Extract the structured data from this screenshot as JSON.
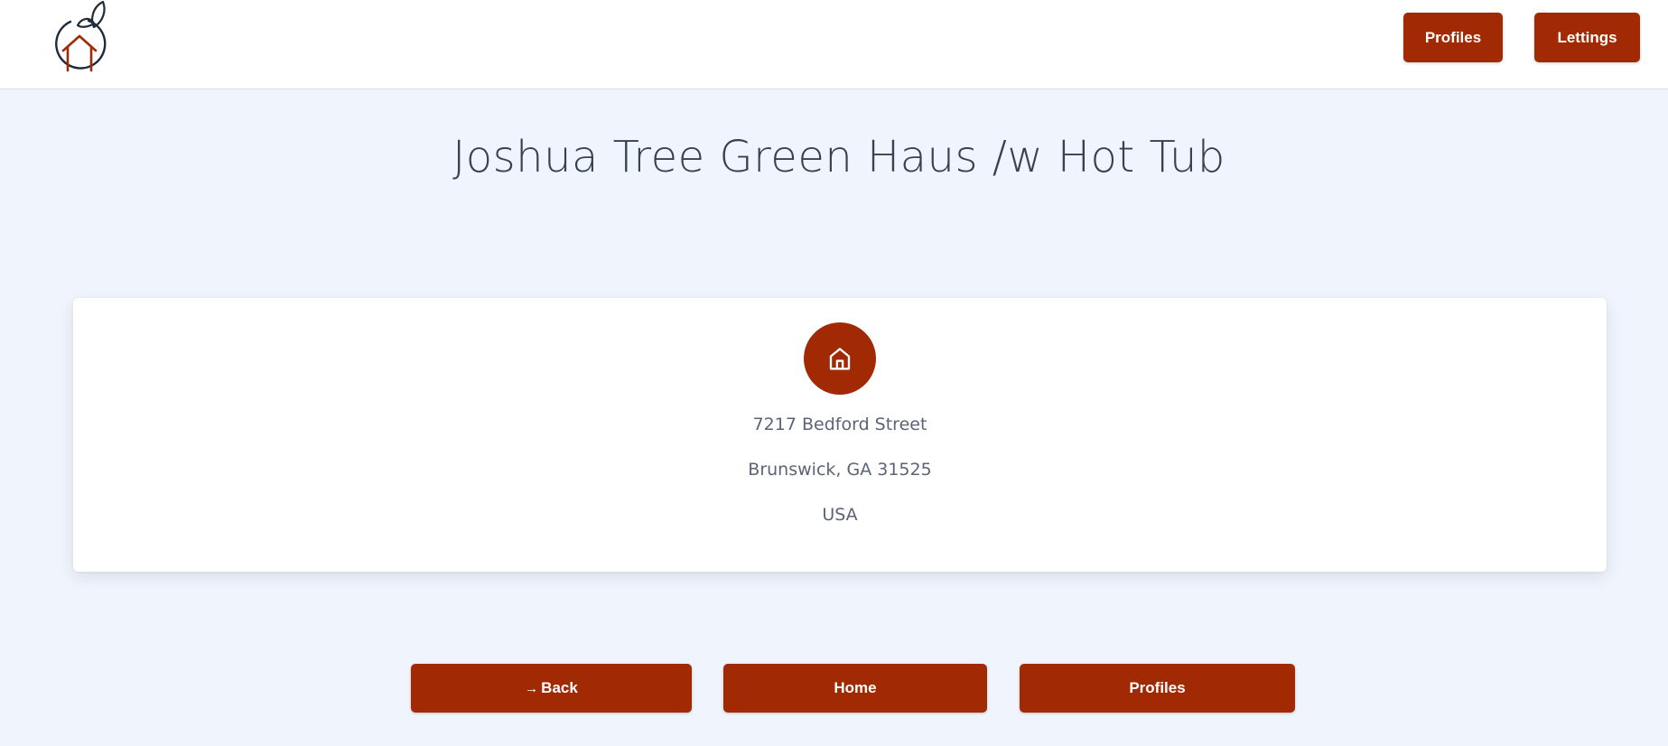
{
  "header": {
    "logo_name": "logo",
    "nav": [
      {
        "label": "Profiles"
      },
      {
        "label": "Lettings"
      }
    ]
  },
  "page": {
    "title": "Joshua Tree Green Haus /w Hot Tub"
  },
  "address": {
    "icon": "home-icon",
    "street": "7217 Bedford Street",
    "city_state_zip": "Brunswick, GA 31525",
    "country": "USA"
  },
  "actions": {
    "back_icon": "→",
    "back_label": "Back",
    "home_label": "Home",
    "profiles_label": "Profiles"
  },
  "colors": {
    "accent": "#a12a04",
    "background": "#f0f4fc",
    "logo_stroke": "#1d2b3a"
  }
}
